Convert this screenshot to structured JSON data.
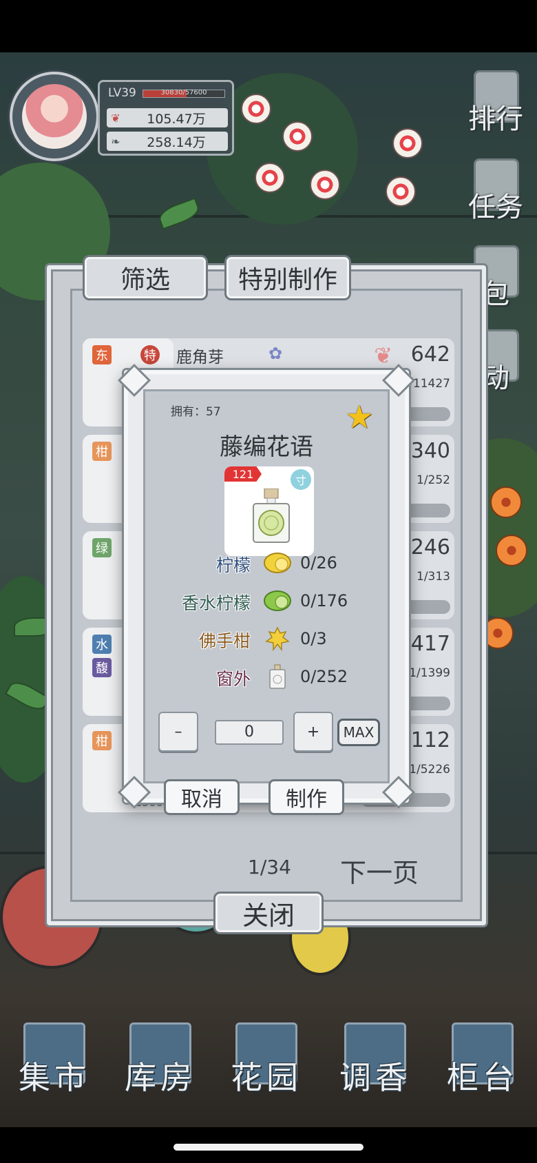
{
  "player": {
    "level": "LV39",
    "exp_text": "30830/57600",
    "exp_fraction": 0.535,
    "currency1": "105.47万",
    "currency2": "258.14万"
  },
  "side_nav": [
    {
      "label": "排行",
      "icon": "ranking-icon"
    },
    {
      "label": "任务",
      "icon": "task-icon"
    },
    {
      "label": "包",
      "icon": "bag-icon"
    },
    {
      "label": "动",
      "icon": "event-icon"
    }
  ],
  "tabs": {
    "filter": "筛选",
    "special": "特别制作"
  },
  "rows": [
    {
      "tag1": "东",
      "tag2": "特",
      "name": "鹿角芽",
      "score": "642",
      "ratio": "1/11427",
      "progress": 0.5
    },
    {
      "tag1": "柑",
      "score": "3340",
      "ratio": "1/252",
      "progress": 0.0
    },
    {
      "tag1": "绿",
      "score": "4246",
      "ratio": "1/313",
      "progress": 0.0
    },
    {
      "tag1": "水",
      "tag2": "馥",
      "score": "3417",
      "ratio": "1/1399",
      "progress": 0.35
    },
    {
      "tag1": "柑",
      "score": "4112",
      "ratio": "1/5226",
      "progress": 0.0,
      "extra": "1500"
    }
  ],
  "pagination": {
    "page": "1/34",
    "next": "下一页"
  },
  "close_label": "关闭",
  "dialog": {
    "owned": "拥有：57",
    "title": "藤编花语",
    "product_count": "121",
    "product_badge": "寸",
    "ingredients": [
      {
        "name": "柠檬",
        "value": "0/26",
        "color": "#2f4e7a",
        "icon": "lemon-icon"
      },
      {
        "name": "香水柠檬",
        "value": "0/176",
        "color": "#2f5a4f",
        "icon": "lime-icon"
      },
      {
        "name": "佛手柑",
        "value": "0/3",
        "color": "#8a5a1e",
        "icon": "bergamot-icon"
      },
      {
        "name": "窗外",
        "value": "0/252",
        "color": "#6a2f4a",
        "icon": "perfume-bottle-icon"
      }
    ],
    "minus": "–",
    "qty": "0",
    "plus": "+",
    "max": "MAX",
    "cancel": "取消",
    "make": "制作"
  },
  "bottom_nav": [
    {
      "label": "集市",
      "icon": "market-icon"
    },
    {
      "label": "库房",
      "icon": "warehouse-icon"
    },
    {
      "label": "花园",
      "icon": "garden-icon"
    },
    {
      "label": "调香",
      "icon": "perfume-mixing-icon"
    },
    {
      "label": "柜台",
      "icon": "counter-icon"
    }
  ],
  "colors": {
    "accent_red": "#c8473b",
    "tag_orange": "#e0653a",
    "star": "#f2c21b"
  }
}
